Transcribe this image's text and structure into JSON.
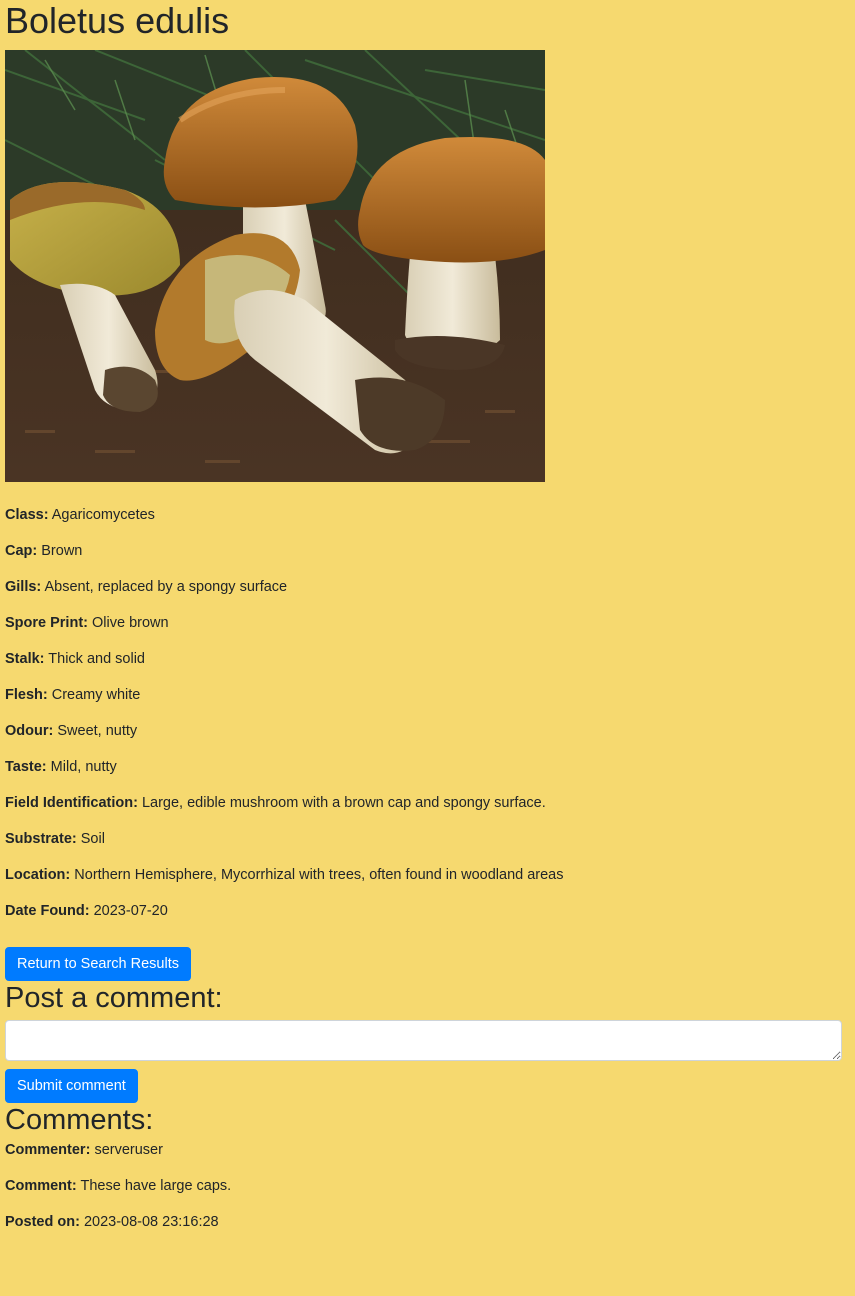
{
  "page": {
    "title": "Boletus edulis",
    "image_alt": "Boletus edulis"
  },
  "properties": [
    {
      "label": "Class:",
      "value": "Agaricomycetes"
    },
    {
      "label": "Cap:",
      "value": "Brown"
    },
    {
      "label": "Gills:",
      "value": "Absent, replaced by a spongy surface"
    },
    {
      "label": "Spore Print:",
      "value": "Olive brown"
    },
    {
      "label": "Stalk:",
      "value": "Thick and solid"
    },
    {
      "label": "Flesh:",
      "value": "Creamy white"
    },
    {
      "label": "Odour:",
      "value": "Sweet, nutty"
    },
    {
      "label": "Taste:",
      "value": "Mild, nutty"
    },
    {
      "label": "Field Identification:",
      "value": "Large, edible mushroom with a brown cap and spongy surface."
    },
    {
      "label": "Substrate:",
      "value": "Soil"
    },
    {
      "label": "Location:",
      "value": "Northern Hemisphere, Mycorrhizal with trees, often found in woodland areas"
    },
    {
      "label": "Date Found:",
      "value": "2023-07-20"
    }
  ],
  "buttons": {
    "return_label": "Return to Search Results",
    "submit_label": "Submit comment"
  },
  "comment_form": {
    "heading": "Post a comment:",
    "value": "",
    "placeholder": ""
  },
  "comments": {
    "heading": "Comments:",
    "items": [
      {
        "commenter_label": "Commenter:",
        "commenter": "serveruser",
        "comment_label": "Comment:",
        "comment": "These have large caps.",
        "posted_label": "Posted on:",
        "posted": "2023-08-08 23:16:28"
      }
    ]
  },
  "colors": {
    "background": "#f6d96f",
    "primary_button": "#007bff",
    "text": "#212529"
  }
}
